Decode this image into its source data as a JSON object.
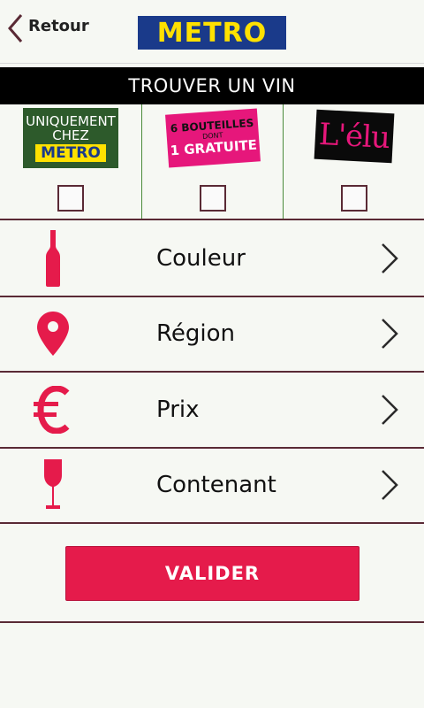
{
  "header": {
    "back_label": "Retour",
    "logo_text": "METRO"
  },
  "title": "TROUVER UN VIN",
  "filters": [
    {
      "name": "uniquement-chez-metro",
      "lines": [
        "UNIQUEMENT",
        "CHEZ",
        "METRO"
      ],
      "checked": false
    },
    {
      "name": "six-bouteilles-dont-une-gratuite",
      "lines": [
        "6 BOUTEILLES",
        "DONT",
        "1 GRATUITE"
      ],
      "checked": false
    },
    {
      "name": "l-elu",
      "lines": [
        "L'élu"
      ],
      "checked": false
    }
  ],
  "menu": [
    {
      "label": "Couleur",
      "icon": "wine-bottle-icon"
    },
    {
      "label": "Région",
      "icon": "location-pin-icon"
    },
    {
      "label": "Prix",
      "icon": "euro-icon"
    },
    {
      "label": "Contenant",
      "icon": "wine-glass-icon"
    }
  ],
  "submit_label": "VALIDER",
  "colors": {
    "accent": "#e51b4b",
    "logo_bg": "#1a3a8a",
    "logo_text": "#ffe100",
    "divider": "#5a2a35"
  }
}
